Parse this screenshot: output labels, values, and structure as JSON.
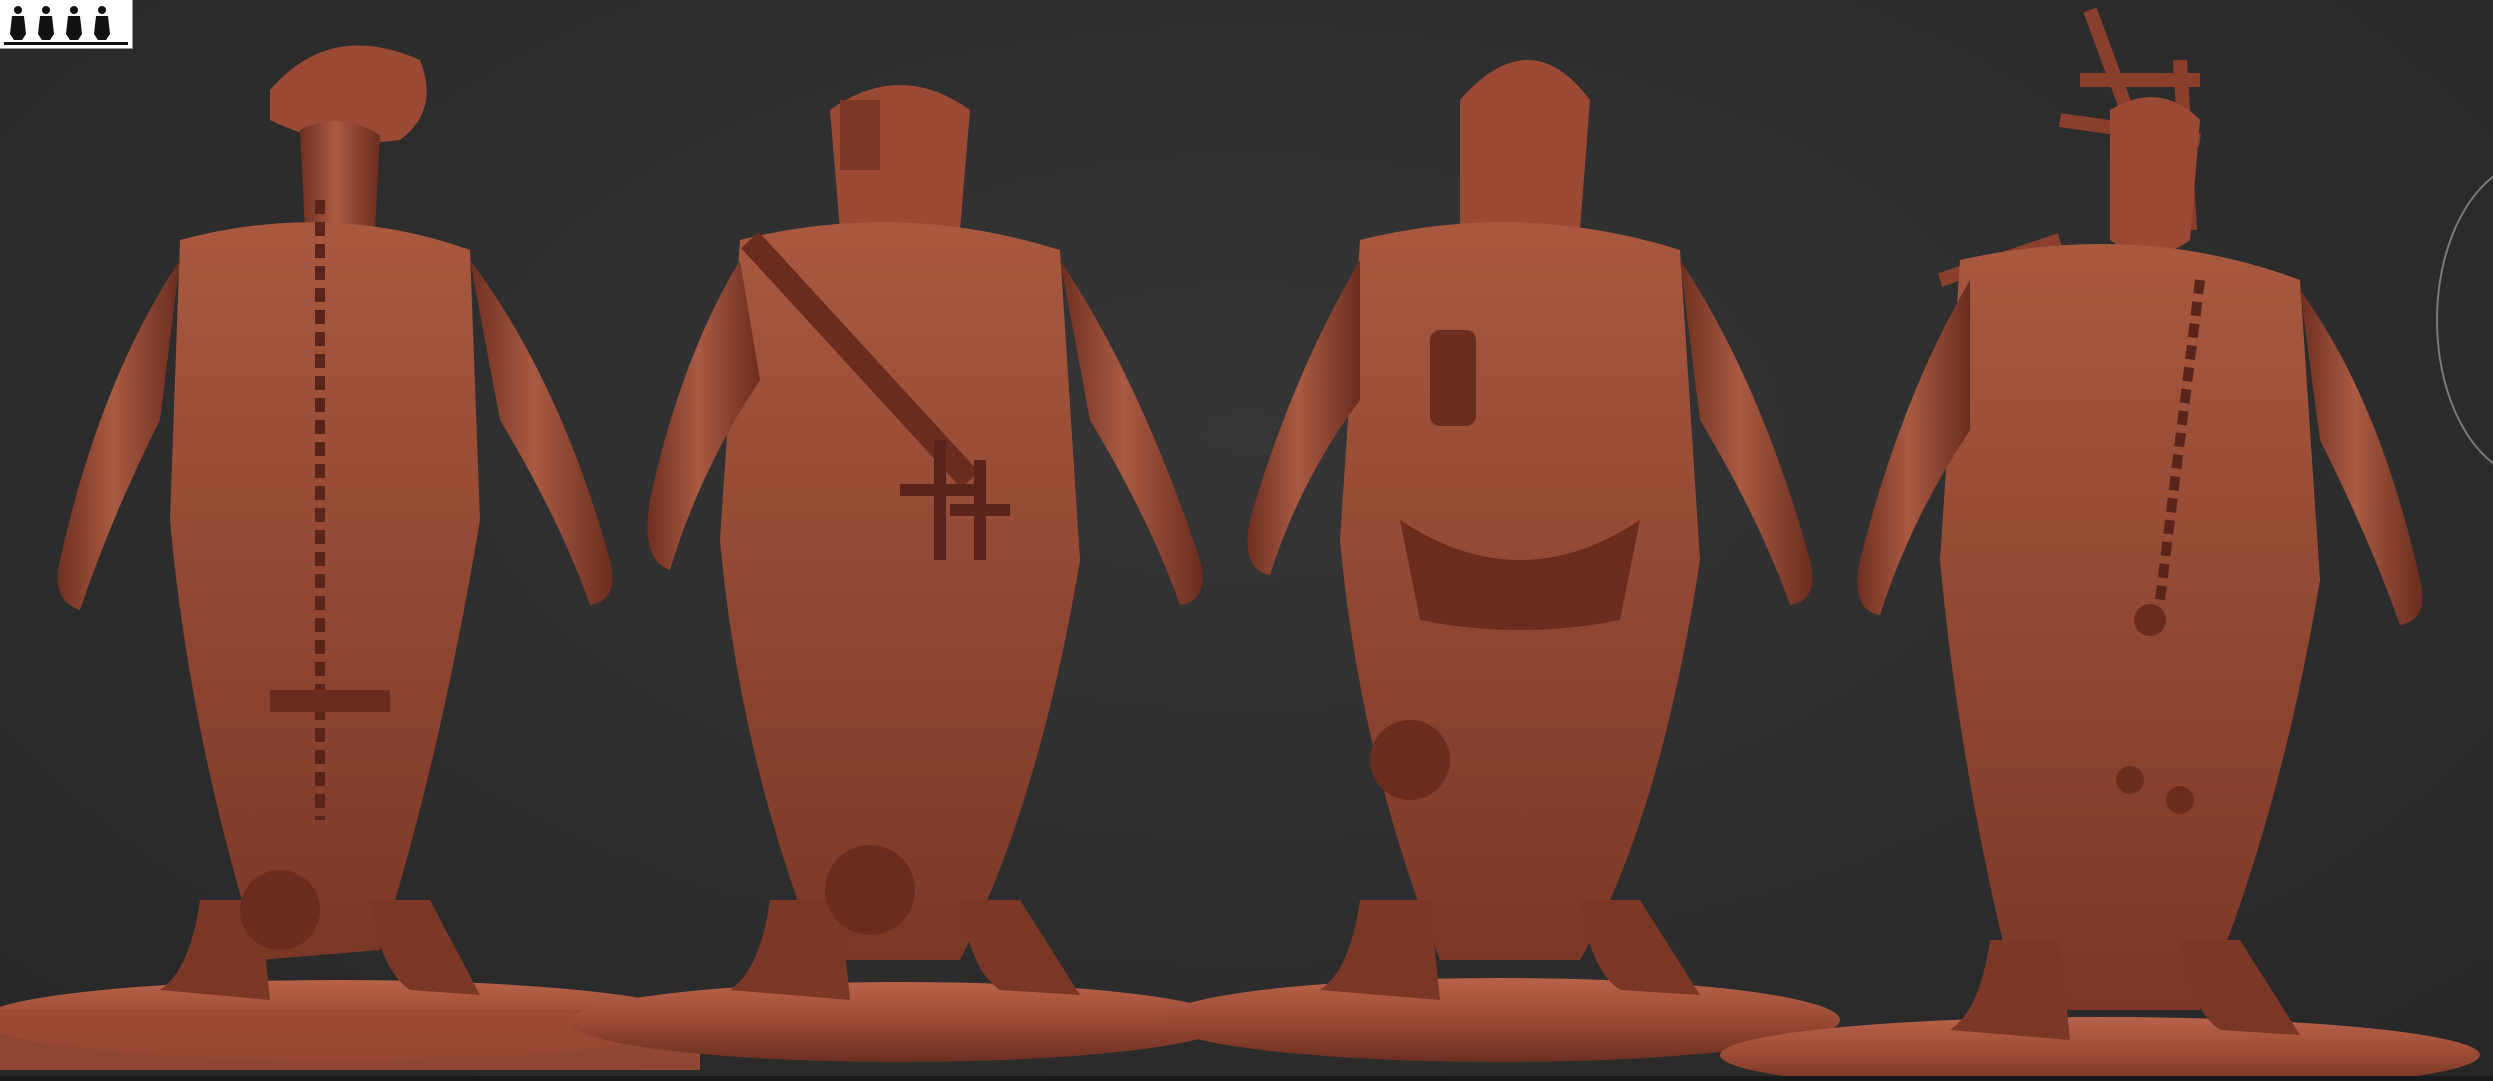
{
  "app": {
    "viewport_background": "#2c2c2c",
    "material_color": "#9a4a34",
    "material_highlight": "#c46a50",
    "material_shadow": "#5a241a"
  },
  "thumbnail": {
    "icon": "figures-silhouette-icon",
    "figure_count": 4
  },
  "scene": {
    "figures": [
      {
        "name": "ghoul-figure-1",
        "headgear": "tricorn-hat"
      },
      {
        "name": "ghoul-figure-2",
        "headgear": "hood-with-cross"
      },
      {
        "name": "ghoul-figure-3",
        "headgear": "tattered-hood"
      },
      {
        "name": "ghoul-figure-4",
        "headgear": "wooden-cross-frame"
      }
    ],
    "gizmo_icon": "navigation-orbit-icon"
  }
}
